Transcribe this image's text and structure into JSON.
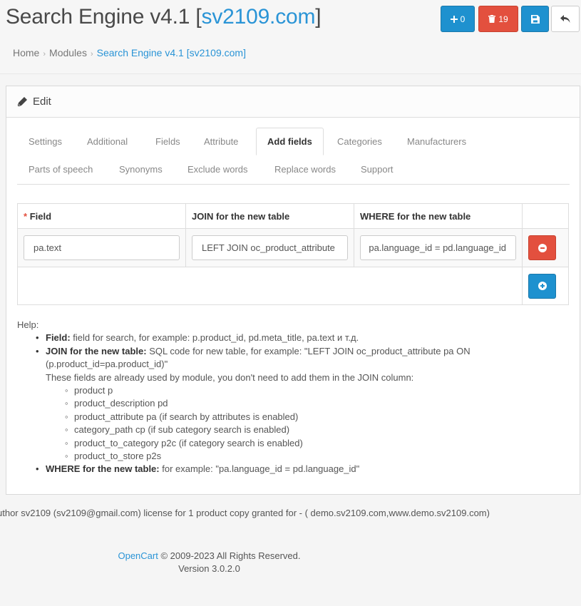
{
  "header": {
    "title_prefix": "Search Engine v4.1 [",
    "title_link": "sv2109.com",
    "title_suffix": "]",
    "buttons": {
      "add_count": "0",
      "delete_count": "19"
    }
  },
  "breadcrumb": {
    "items": [
      "Home",
      "Modules",
      "Search Engine v4.1 [sv2109.com]"
    ],
    "separator": "›"
  },
  "panel": {
    "title": "Edit"
  },
  "tabs": [
    "Settings",
    "Additional",
    "Fields",
    "Attribute",
    "Add fields",
    "Categories",
    "Manufacturers",
    "Parts of speech",
    "Synonyms",
    "Exclude words",
    "Replace words",
    "Support"
  ],
  "active_tab": "Add fields",
  "table": {
    "columns": [
      "Field",
      "JOIN for the new table",
      "WHERE for the new table"
    ],
    "required_marker": "*",
    "rows": [
      {
        "field": "pa.text",
        "join": "LEFT JOIN oc_product_attribute",
        "where": "pa.language_id = pd.language_id"
      }
    ]
  },
  "help": {
    "heading": "Help:",
    "items": {
      "field_label": "Field:",
      "field_text": " field for search, for example: p.product_id, pd.meta_title, pa.text и т.д.",
      "join_label": "JOIN for the new table:",
      "join_text": " SQL code for new table, for example: \"LEFT JOIN oc_product_attribute pa ON (p.product_id=pa.product_id)\"",
      "join_note": "These fields are already used by module, you don't need to add them in the JOIN column:",
      "join_sub": [
        "product p",
        "product_description pd",
        "product_attribute pa (if search by attributes is enabled)",
        "category_path cp (if sub category search is enabled)",
        "product_to_category p2c (if category search is enabled)",
        "product_to_store p2s"
      ],
      "where_label": "WHERE for the new table:",
      "where_text": " for example: \"pa.language_id = pd.language_id\""
    }
  },
  "license": "uthor sv2109 (sv2109@gmail.com) license for 1 product copy granted for - ( demo.sv2109.com,www.demo.sv2109.com)",
  "footer": {
    "brand": "OpenCart",
    "copyright": " © 2009-2023 All Rights Reserved.",
    "version": "Version 3.0.2.0"
  },
  "colors": {
    "primary": "#1e91cf",
    "danger": "#e3503e",
    "link": "#2a94d6"
  }
}
